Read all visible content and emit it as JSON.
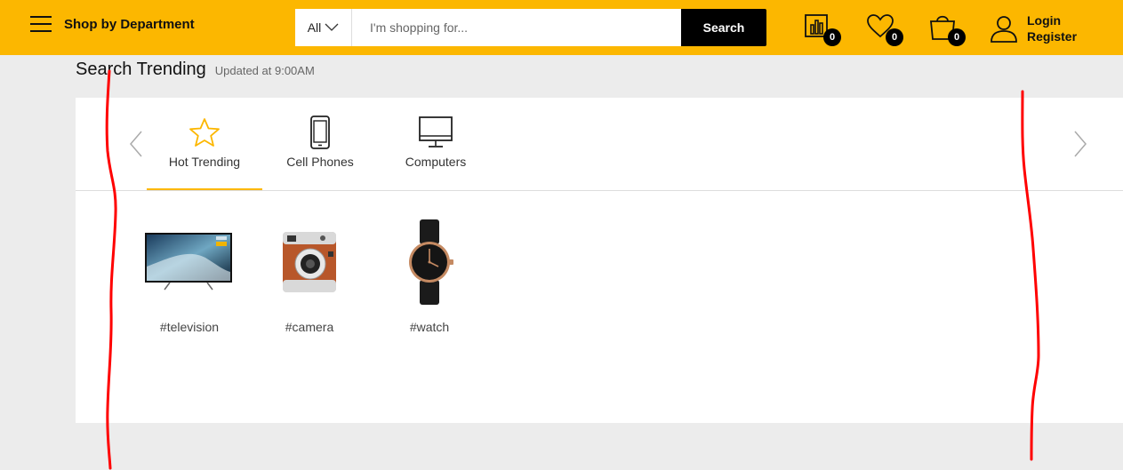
{
  "header": {
    "department_label": "Shop by Department",
    "search": {
      "category": "All",
      "placeholder": "I'm shopping for...",
      "button_label": "Search"
    },
    "compare_count": "0",
    "wishlist_count": "0",
    "cart_count": "0",
    "login_label": "Login",
    "register_label": "Register"
  },
  "section": {
    "title": "Search Trending",
    "updated": "Updated at 9:00AM"
  },
  "tabs": [
    {
      "label": "Hot Trending",
      "icon": "star-icon",
      "active": true
    },
    {
      "label": "Cell Phones",
      "icon": "phone-icon",
      "active": false
    },
    {
      "label": "Computers",
      "icon": "monitor-icon",
      "active": false
    }
  ],
  "items": [
    {
      "tag": "#television",
      "icon": "television-image"
    },
    {
      "tag": "#camera",
      "icon": "camera-image"
    },
    {
      "tag": "#watch",
      "icon": "watch-image"
    }
  ],
  "colors": {
    "brand": "#fcb700",
    "annotation": "#ff0000"
  }
}
